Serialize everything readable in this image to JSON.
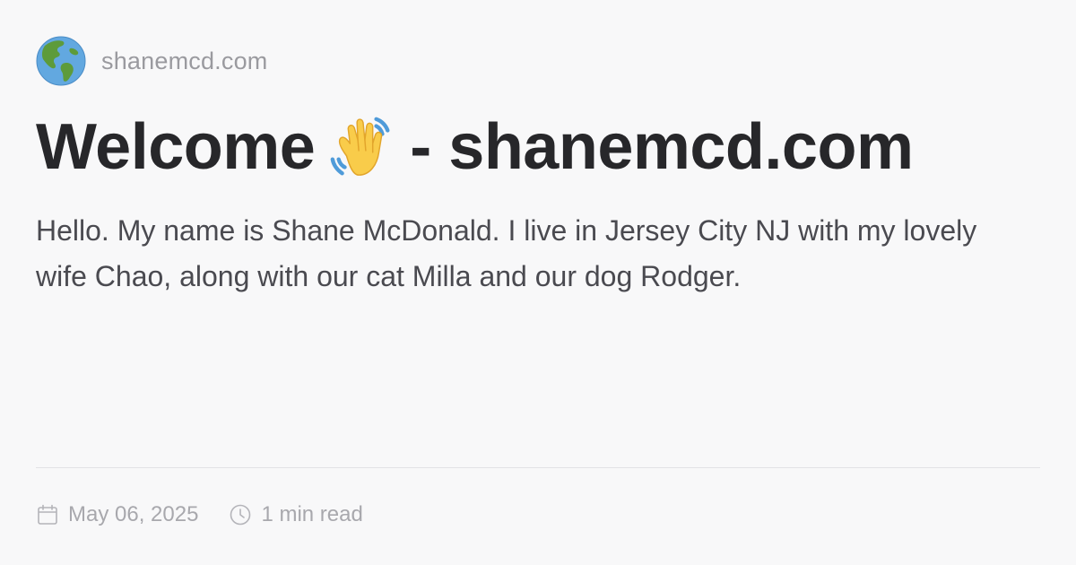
{
  "header": {
    "site_name": "shanemcd.com",
    "logo_icon": "globe-americas-icon"
  },
  "main": {
    "title_before": "Welcome",
    "title_icon": "waving-hand-icon",
    "title_after": "- shanemcd.com",
    "description": "Hello. My name is Shane McDonald. I live in Jersey City NJ with my lovely wife Chao, along with our cat Milla and our dog Rodger."
  },
  "footer": {
    "date": "May 06, 2025",
    "date_icon": "calendar-icon",
    "read_time": "1 min read",
    "read_time_icon": "clock-icon"
  },
  "colors": {
    "background": "#f8f8f9",
    "title": "#27272a",
    "body_text": "#4a4a50",
    "muted_text": "#9a9a9f",
    "divider": "#e2e2e6"
  }
}
